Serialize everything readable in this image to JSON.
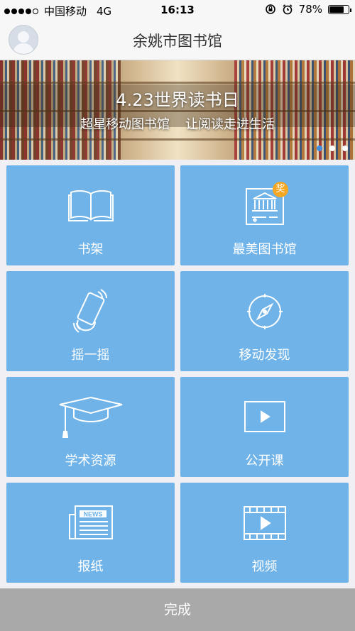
{
  "status_bar": {
    "carrier": "中国移动",
    "network": "4G",
    "time": "16:13",
    "battery_percent": "78%",
    "battery_level": 0.78,
    "signal_bars_filled": 4,
    "signal_bars_total": 5
  },
  "header": {
    "title": "余姚市图书馆",
    "avatar_icon": "user-avatar-icon"
  },
  "banner": {
    "title": "4.23世界读书日",
    "subtitle_left": "超星移动图书馆",
    "subtitle_right": "让阅读走进生活",
    "page_count": 3,
    "active_page": 1
  },
  "tiles": [
    {
      "label": "书架",
      "icon": "open-book-icon"
    },
    {
      "label": "最美图书馆",
      "icon": "library-building-icon",
      "badge": "奖"
    },
    {
      "label": "摇一摇",
      "icon": "shake-phone-icon"
    },
    {
      "label": "移动发现",
      "icon": "compass-icon"
    },
    {
      "label": "学术资源",
      "icon": "graduation-cap-icon"
    },
    {
      "label": "公开课",
      "icon": "play-screen-icon"
    },
    {
      "label": "报纸",
      "icon": "newspaper-icon",
      "icon_text": "NEWS"
    },
    {
      "label": "视频",
      "icon": "film-play-icon"
    }
  ],
  "footer": {
    "done_label": "完成"
  },
  "colors": {
    "tile_background": "#6fb3e8",
    "done_bar": "#a9a9a9",
    "badge": "#f5a623",
    "active_page_dot": "#3d8de0"
  }
}
